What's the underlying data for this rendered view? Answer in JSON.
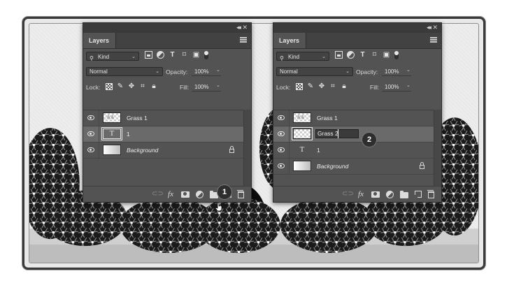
{
  "panels": [
    {
      "tab_label": "Layers",
      "filter_kind": "Kind",
      "blend_mode": "Normal",
      "opacity_label": "Opacity:",
      "opacity_value": "100%",
      "lock_label": "Lock:",
      "fill_label": "Fill:",
      "fill_value": "100%",
      "layers": [
        {
          "name": "Grass 1",
          "thumbnail": "checker-grass",
          "selected": false
        },
        {
          "name": "1",
          "thumbnail": "type",
          "selected": true
        },
        {
          "name": "Background",
          "thumbnail": "gradient",
          "selected": false,
          "locked": true
        }
      ],
      "step_number": "1"
    },
    {
      "tab_label": "Layers",
      "filter_kind": "Kind",
      "blend_mode": "Normal",
      "opacity_label": "Opacity:",
      "opacity_value": "100%",
      "lock_label": "Lock:",
      "fill_label": "Fill:",
      "fill_value": "100%",
      "layers": [
        {
          "name": "Grass 1",
          "thumbnail": "checker-grass",
          "selected": false
        },
        {
          "name": "Grass 2",
          "thumbnail": "checker",
          "selected": true,
          "editing": true
        },
        {
          "name": "1",
          "thumbnail": "type",
          "selected": false
        },
        {
          "name": "Background",
          "thumbnail": "gradient",
          "selected": false,
          "locked": true
        }
      ],
      "step_number": "2"
    }
  ],
  "bottom_icons": [
    "link-icon",
    "fx-icon",
    "mask-icon",
    "adjustment-icon",
    "folder-icon",
    "new-layer-icon",
    "trash-icon"
  ],
  "colors": {
    "panel_bg": "#535353",
    "selected_row": "#6a6a6a",
    "badge_bg": "#2e2e2e"
  }
}
